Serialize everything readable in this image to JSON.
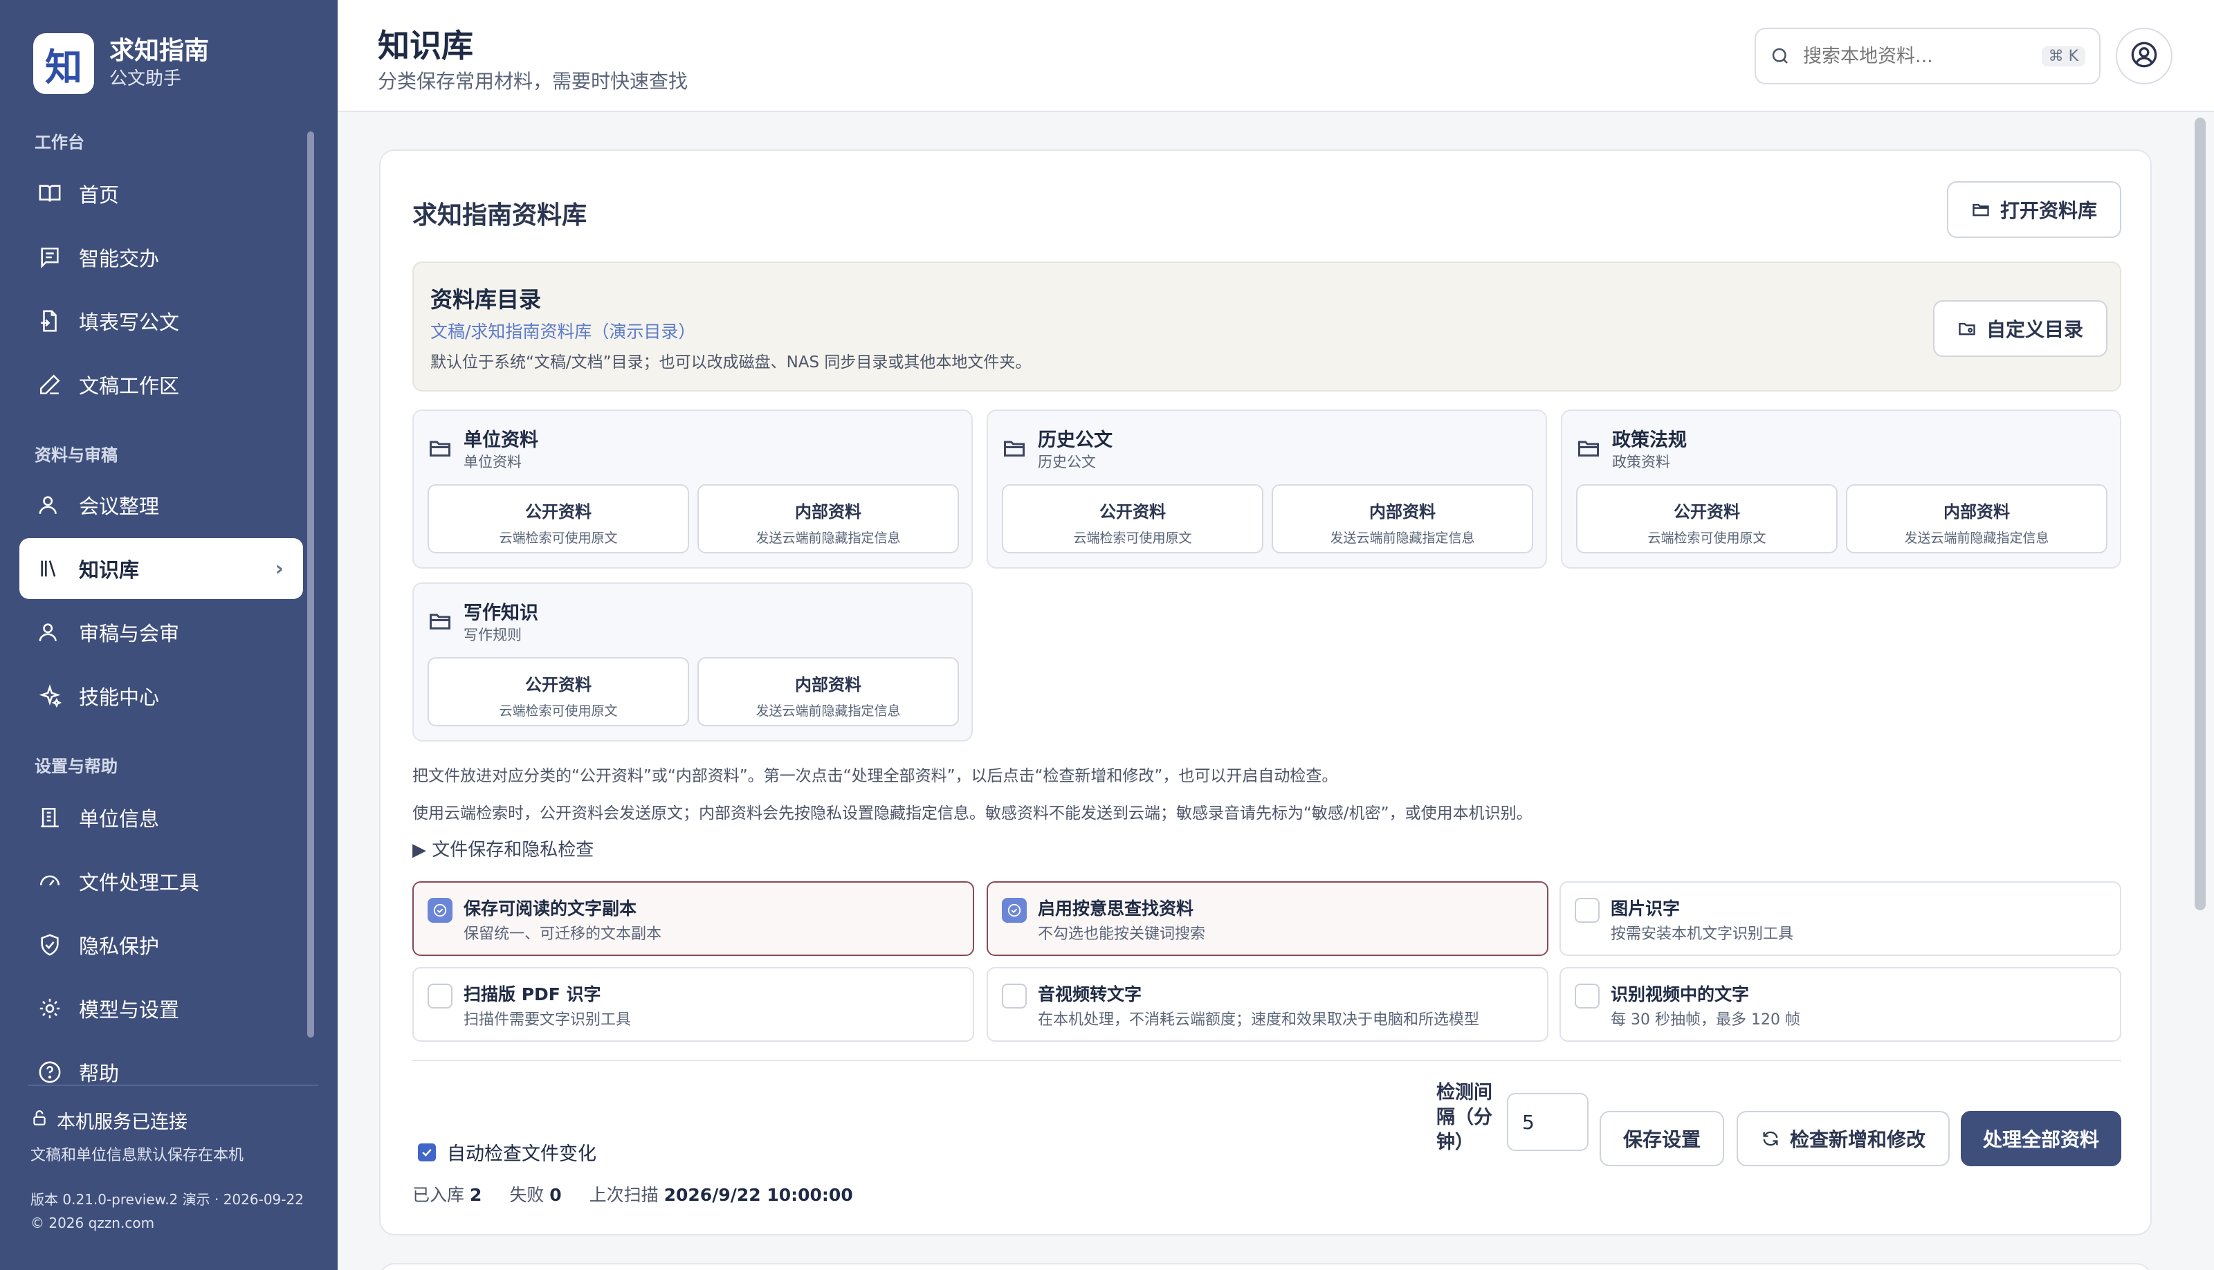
{
  "brand": {
    "logo_char": "知",
    "title": "求知指南",
    "subtitle": "公文助手"
  },
  "sidebar": {
    "sections": [
      "工作台",
      "资料与审稿",
      "设置与帮助"
    ],
    "items": [
      {
        "label": "首页",
        "icon": "book-open-icon"
      },
      {
        "label": "智能交办",
        "icon": "message-square-icon"
      },
      {
        "label": "填表写公文",
        "icon": "file-edit-icon"
      },
      {
        "label": "文稿工作区",
        "icon": "pen-icon"
      },
      {
        "label": "会议整理",
        "icon": "user-icon"
      },
      {
        "label": "知识库",
        "icon": "library-icon",
        "active": true
      },
      {
        "label": "审稿与会审",
        "icon": "users-icon"
      },
      {
        "label": "技能中心",
        "icon": "sparkles-icon"
      },
      {
        "label": "单位信息",
        "icon": "building-icon"
      },
      {
        "label": "文件处理工具",
        "icon": "gauge-icon"
      },
      {
        "label": "隐私保护",
        "icon": "shield-check-icon"
      },
      {
        "label": "模型与设置",
        "icon": "gear-icon"
      },
      {
        "label": "帮助",
        "icon": "help-circle-icon"
      }
    ],
    "service_status": "本机服务已连接",
    "service_desc": "文稿和单位信息默认保存在本机",
    "version": "版本 0.21.0-preview.2 演示 · 2026-09-22",
    "copyright": "© 2026 qzzn.com"
  },
  "header": {
    "title": "知识库",
    "subtitle": "分类保存常用材料，需要时快速查找",
    "search_placeholder": "搜索本地资料...",
    "search_shortcut": "⌘ K"
  },
  "card": {
    "title": "求知指南资料库",
    "open_button": "打开资料库",
    "directory": {
      "title": "资料库目录",
      "path": "文稿/求知指南资料库（演示目录）",
      "desc": "默认位于系统“文稿/文档”目录；也可以改成磁盘、NAS 同步目录或其他本地文件夹。",
      "custom_button": "自定义目录"
    },
    "categories": [
      {
        "title": "单位资料",
        "sub": "单位资料"
      },
      {
        "title": "历史公文",
        "sub": "历史公文"
      },
      {
        "title": "政策法规",
        "sub": "政策资料"
      },
      {
        "title": "写作知识",
        "sub": "写作规则"
      }
    ],
    "public_label": "公开资料",
    "public_desc": "云端检索可使用原文",
    "internal_label": "内部资料",
    "internal_desc": "发送云端前隐藏指定信息",
    "info1": "把文件放进对应分类的“公开资料”或“内部资料”。第一次点击“处理全部资料”，以后点击“检查新增和修改”，也可以开启自动检查。",
    "info2": "使用云端检索时，公开资料会发送原文；内部资料会先按隐私设置隐藏指定信息。敏感资料不能发送到云端；敏感录音请先标为“敏感/机密”，或使用本机识别。",
    "details_label": "▶ 文件保存和隐私检查",
    "options": [
      {
        "title": "保存可阅读的文字副本",
        "desc": "保留统一、可迁移的文本副本",
        "checked": true
      },
      {
        "title": "启用按意思查找资料",
        "desc": "不勾选也能按关键词搜索",
        "checked": true
      },
      {
        "title": "图片识字",
        "desc": "按需安装本机文字识别工具",
        "checked": false
      },
      {
        "title": "扫描版 PDF 识字",
        "desc": "扫描件需要文字识别工具",
        "checked": false
      },
      {
        "title": "音视频转文字",
        "desc": "在本机处理，不消耗云端额度；速度和效果取决于电脑和所选模型",
        "checked": false
      },
      {
        "title": "识别视频中的文字",
        "desc": "每 30 秒抽帧，最多 120 帧",
        "checked": false
      }
    ],
    "auto_check_label": "自动检查文件变化",
    "auto_check": true,
    "interval_label": "检测间隔（分钟）",
    "interval_value": "5",
    "save_button": "保存设置",
    "check_button": "检查新增和修改",
    "process_button": "处理全部资料",
    "stats": {
      "indexed_label": "已入库",
      "indexed_value": "2",
      "failed_label": "失败",
      "failed_value": "0",
      "last_scan_label": "上次扫描",
      "last_scan_value": "2026/9/22 10:00:00"
    }
  }
}
